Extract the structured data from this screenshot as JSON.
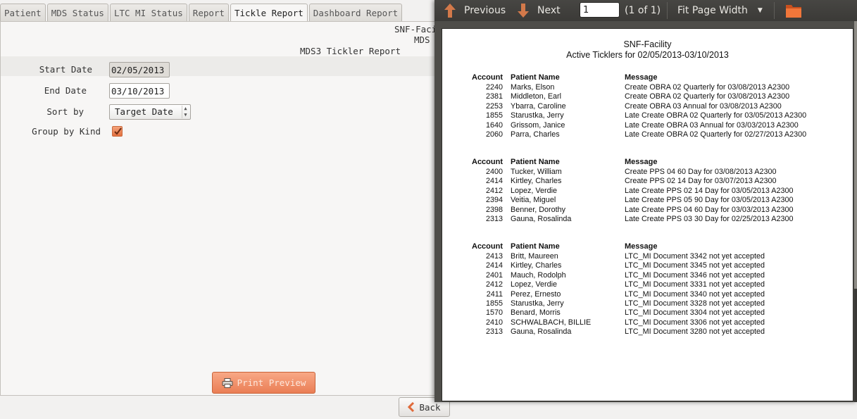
{
  "tabs": [
    {
      "label": "Patient"
    },
    {
      "label": "MDS Status"
    },
    {
      "label": "LTC MI Status"
    },
    {
      "label": "Report"
    },
    {
      "label": "Tickle Report"
    },
    {
      "label": "Dashboard Report"
    }
  ],
  "header": {
    "line1": "SNF-Faci",
    "line2": "MDS",
    "line3": "MDS3 Tickler Report"
  },
  "form": {
    "start_label": "Start Date",
    "start_value": "02/05/2013",
    "end_label": "End Date",
    "end_value": "03/10/2013",
    "sort_label": "Sort by",
    "sort_value": "Target Date",
    "group_label": "Group by Kind",
    "group_checked": true
  },
  "buttons": {
    "print_preview": "Print Preview",
    "back": "Back"
  },
  "viewer": {
    "previous": "Previous",
    "next": "Next",
    "page_value": "1",
    "page_count": "(1 of 1)",
    "zoom": "Fit Page Width"
  },
  "report": {
    "facility": "SNF-Facility",
    "subtitle": "Active Ticklers for 02/05/2013-03/10/2013",
    "columns": {
      "account": "Account",
      "name": "Patient Name",
      "message": "Message"
    },
    "groups": [
      {
        "rows": [
          {
            "account": "2240",
            "name": "Marks, Elson",
            "message": "Create OBRA 02 Quarterly for 03/08/2013 A2300"
          },
          {
            "account": "2381",
            "name": "Middleton, Earl",
            "message": "Create OBRA 02 Quarterly for 03/08/2013 A2300"
          },
          {
            "account": "2253",
            "name": "Ybarra, Caroline",
            "message": "Create OBRA 03 Annual for 03/08/2013 A2300"
          },
          {
            "account": "1855",
            "name": "Starustka, Jerry",
            "message": "Late Create OBRA 02 Quarterly for 03/05/2013 A2300"
          },
          {
            "account": "1640",
            "name": "Grissom, Janice",
            "message": "Late Create OBRA 03 Annual for 03/03/2013 A2300"
          },
          {
            "account": "2060",
            "name": "Parra, Charles",
            "message": "Late Create OBRA 02 Quarterly for 02/27/2013 A2300"
          }
        ]
      },
      {
        "rows": [
          {
            "account": "2400",
            "name": "Tucker, William",
            "message": "Create PPS 04 60 Day for 03/08/2013 A2300"
          },
          {
            "account": "2414",
            "name": "Kirtley, Charles",
            "message": "Create PPS 02 14 Day for 03/07/2013 A2300"
          },
          {
            "account": "2412",
            "name": "Lopez, Verdie",
            "message": "Late Create PPS 02 14 Day for 03/05/2013 A2300"
          },
          {
            "account": "2394",
            "name": "Veitia, Miguel",
            "message": "Late Create PPS 05 90 Day for 03/05/2013 A2300"
          },
          {
            "account": "2398",
            "name": "Benner, Dorothy",
            "message": "Late Create PPS 04 60 Day for 03/03/2013 A2300"
          },
          {
            "account": "2313",
            "name": "Gauna, Rosalinda",
            "message": "Late Create PPS 03 30 Day for 02/25/2013 A2300"
          }
        ]
      },
      {
        "rows": [
          {
            "account": "2413",
            "name": "Britt, Maureen",
            "message": "LTC_MI Document 3342 not yet accepted"
          },
          {
            "account": "2414",
            "name": "Kirtley, Charles",
            "message": "LTC_MI Document 3345 not yet accepted"
          },
          {
            "account": "2401",
            "name": "Mauch, Rodolph",
            "message": "LTC_MI Document 3346 not yet accepted"
          },
          {
            "account": "2412",
            "name": "Lopez, Verdie",
            "message": "LTC_MI Document 3331 not yet accepted"
          },
          {
            "account": "2411",
            "name": "Perez, Ernesto",
            "message": "LTC_MI Document 3340 not yet accepted"
          },
          {
            "account": "1855",
            "name": "Starustka, Jerry",
            "message": "LTC_MI Document 3328 not yet accepted"
          },
          {
            "account": "1570",
            "name": "Benard, Morris",
            "message": "LTC_MI Document 3304 not yet accepted"
          },
          {
            "account": "2410",
            "name": "SCHWALBACH, BILLIE",
            "message": "LTC_MI Document 3306 not yet accepted"
          },
          {
            "account": "2313",
            "name": "Gauna, Rosalinda",
            "message": "LTC_MI Document 3280 not yet accepted"
          }
        ]
      }
    ]
  },
  "colors": {
    "accent": "#ea7e55",
    "toolbar": "#3f3e3b",
    "arrow": "#c8643a"
  }
}
